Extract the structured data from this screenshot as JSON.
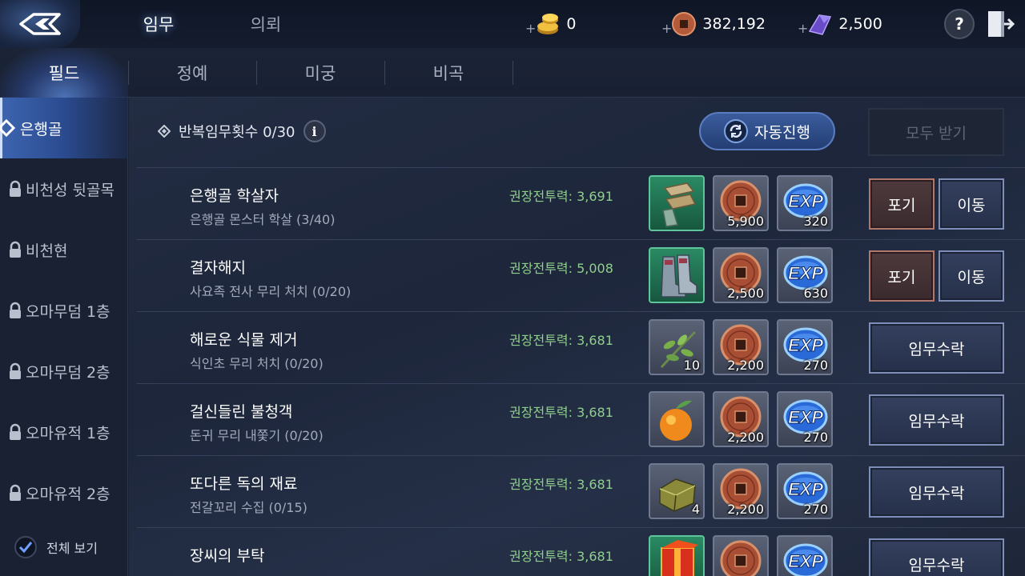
{
  "header": {
    "tabs": [
      {
        "label": "임무",
        "active": true
      },
      {
        "label": "의뢰",
        "active": false
      }
    ],
    "currencies": [
      {
        "icon": "gold-ingot-icon",
        "value": "0"
      },
      {
        "icon": "copper-coin-icon",
        "value": "382,192"
      },
      {
        "icon": "purple-crystal-icon",
        "value": "2,500"
      }
    ],
    "plus": "+",
    "help": "?"
  },
  "subtabs": [
    {
      "label": "필드",
      "active": true
    },
    {
      "label": "정예",
      "active": false
    },
    {
      "label": "미궁",
      "active": false
    },
    {
      "label": "비곡",
      "active": false
    }
  ],
  "sidebar": {
    "items": [
      {
        "label": "은행골",
        "locked": false,
        "active": true
      },
      {
        "label": "비천성 뒷골목",
        "locked": true
      },
      {
        "label": "비천현",
        "locked": true
      },
      {
        "label": "오마무덤 1층",
        "locked": true
      },
      {
        "label": "오마무덤 2층",
        "locked": true
      },
      {
        "label": "오마유적 1층",
        "locked": true
      },
      {
        "label": "오마유적 2층",
        "locked": true
      }
    ],
    "view_all": "전체 보기",
    "view_all_checked": true
  },
  "content": {
    "repeat_info": "반복임무횟수 0/30",
    "auto_button": "자동진행",
    "receive_all": "모두 받기",
    "exp_label": "EXP",
    "quests": [
      {
        "title": "은행골 학살자",
        "sub": "은행골 몬스터 학살 (3/40)",
        "power": "권장전투력: 3,691",
        "item": {
          "icon": "gauntlet-icon",
          "qty": "",
          "green": true
        },
        "coins": "5,900",
        "exp": "320",
        "buttons": {
          "giveup": "포기",
          "move": "이동"
        }
      },
      {
        "title": "결자해지",
        "sub": "사요족 전사 무리 처치 (0/20)",
        "power": "권장전투력: 5,008",
        "item": {
          "icon": "boots-icon",
          "qty": "",
          "green": true
        },
        "coins": "2,500",
        "exp": "630",
        "buttons": {
          "giveup": "포기",
          "move": "이동"
        }
      },
      {
        "title": "해로운 식물 제거",
        "sub": "식인초 무리 처치 (0/20)",
        "power": "권장전투력: 3,681",
        "item": {
          "icon": "herb-icon",
          "qty": "10",
          "green": false
        },
        "coins": "2,200",
        "exp": "270",
        "buttons": {
          "accept": "임무수락"
        }
      },
      {
        "title": "걸신들린 불청객",
        "sub": "돈귀 무리 내쫓기 (0/20)",
        "power": "권장전투력: 3,681",
        "item": {
          "icon": "fruit-icon",
          "qty": "",
          "green": false
        },
        "coins": "2,200",
        "exp": "270",
        "buttons": {
          "accept": "임무수락"
        }
      },
      {
        "title": "또다른 독의 재료",
        "sub": "전갈꼬리 수집 (0/15)",
        "power": "권장전투력: 3,681",
        "item": {
          "icon": "ore-icon",
          "qty": "4",
          "green": false
        },
        "coins": "2,200",
        "exp": "270",
        "buttons": {
          "accept": "임무수락"
        }
      },
      {
        "title": "장씨의 부탁",
        "sub": "",
        "power": "권장전투력: 3,681",
        "item": {
          "icon": "red-box-icon",
          "qty": "",
          "green": true
        },
        "coins": "",
        "exp": "",
        "buttons": {
          "accept": "임무수락"
        }
      }
    ]
  },
  "colors": {
    "accent": "#3d64b0",
    "power_text": "#8fd08a",
    "giveup_border": "#b0786a"
  }
}
